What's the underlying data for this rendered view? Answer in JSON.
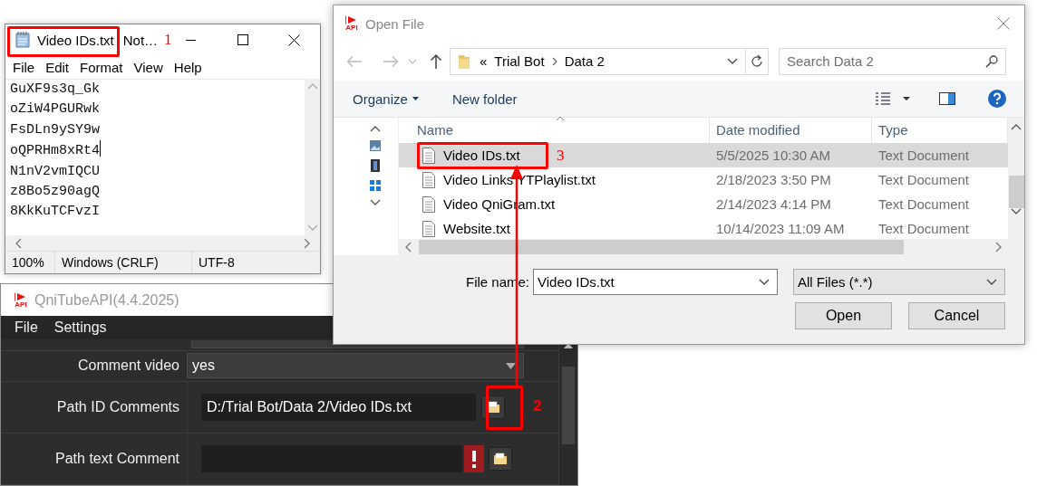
{
  "notepad": {
    "title": "Video IDs.txt",
    "app_title": "Not…",
    "menu": [
      "File",
      "Edit",
      "Format",
      "View",
      "Help"
    ],
    "lines": [
      {
        "text": "GuXF9s3q_Gk",
        "caret": false
      },
      {
        "text": "oZiW4PGURwk",
        "caret": false
      },
      {
        "text": "FsDLn9ySY9w",
        "caret": false
      },
      {
        "text": "oQPRHm8xRt4",
        "caret": true
      },
      {
        "text": "N1nV2vmIQCU",
        "caret": false
      },
      {
        "text": "z8Bo5z90agQ",
        "caret": false
      },
      {
        "text": "8KkKuTCFvzI",
        "caret": false
      }
    ],
    "status": [
      "100%",
      "Windows (CRLF)",
      "UTF-8"
    ]
  },
  "app": {
    "icon_label": "API",
    "title": "QniTubeAPI(4.4.2025)",
    "menu": [
      "File",
      "Settings"
    ],
    "fields": [
      {
        "kind": "combo",
        "label": "Comment video",
        "value": "yes"
      },
      {
        "kind": "path",
        "label": "Path ID Comments",
        "value": "D:/Trial Bot/Data 2/Video IDs.txt",
        "error": false
      },
      {
        "kind": "path",
        "label": "Path text Comment",
        "error": true
      }
    ]
  },
  "open_file_dialog": {
    "icon_label": "API",
    "title": "Open File",
    "breadcrumb": [
      "«",
      "Trial Bot",
      "Data 2"
    ],
    "search": {
      "placeholder": "Search Data 2"
    },
    "toolbar": [
      "Organize",
      "New folder"
    ],
    "columns": [
      "Name",
      "Date modified",
      "Type"
    ],
    "rows": [
      {
        "name": "Video IDs.txt",
        "date": "5/5/2025 10:30 AM",
        "type": "Text Document",
        "selected": true
      },
      {
        "name": "Video Links YTPlaylist.txt",
        "date": "2/18/2023 3:50 PM",
        "type": "Text Document",
        "selected": false
      },
      {
        "name": "Video QniGram.txt",
        "date": "2/14/2023 4:14 PM",
        "type": "Text Document",
        "selected": false
      },
      {
        "name": "Website.txt",
        "date": "10/14/2023 11:09 AM",
        "type": "Text Document",
        "selected": false
      }
    ],
    "file_name_label": "File name:",
    "file_name": "Video IDs.txt",
    "filter": "All Files (*.*)",
    "buttons": [
      "Open",
      "Cancel"
    ]
  },
  "annotations": [
    {
      "label": "1"
    },
    {
      "label": "2"
    },
    {
      "label": "3"
    }
  ]
}
